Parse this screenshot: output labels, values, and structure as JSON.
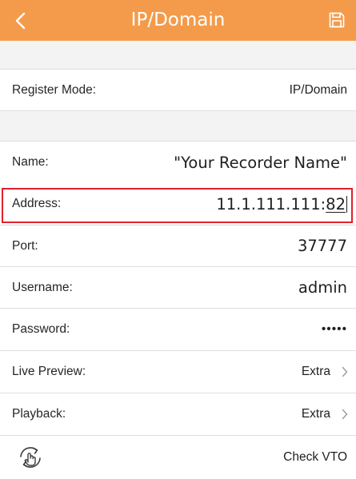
{
  "header": {
    "title": "IP/Domain",
    "back_icon": "chevron-left-icon",
    "save_icon": "save-icon",
    "background": "#f49b4b"
  },
  "register_mode": {
    "label": "Register Mode:",
    "value": "IP/Domain"
  },
  "fields": {
    "name": {
      "label": "Name:",
      "value": "\"Your Recorder Name\""
    },
    "address": {
      "label": "Address:",
      "value_plain": "11.1.111.111:",
      "value_underlined": "82"
    },
    "port": {
      "label": "Port:",
      "value": "37777"
    },
    "username": {
      "label": "Username:",
      "value": "admin"
    },
    "password": {
      "label": "Password:",
      "value": "•••••"
    },
    "live_preview": {
      "label": "Live Preview:",
      "value": "Extra"
    },
    "playback": {
      "label": "Playback:",
      "value": "Extra"
    }
  },
  "check_vto": {
    "icon": "rotate-hand-icon",
    "label": "Check VTO"
  },
  "colors": {
    "accent": "#f49b4b",
    "highlight_border": "#e0212b"
  }
}
